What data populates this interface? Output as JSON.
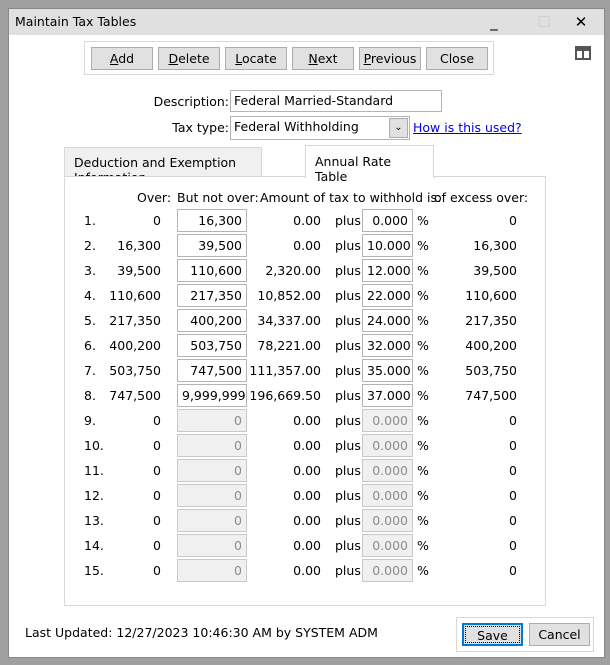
{
  "window": {
    "title": "Maintain Tax Tables",
    "minimize": "_",
    "maximize": "☐",
    "close": "✕"
  },
  "toolbar": [
    {
      "key": "add",
      "pre": "",
      "u": "A",
      "post": "dd"
    },
    {
      "key": "delete",
      "pre": "",
      "u": "D",
      "post": "elete"
    },
    {
      "key": "locate",
      "pre": "",
      "u": "L",
      "post": "ocate"
    },
    {
      "key": "next",
      "pre": "",
      "u": "N",
      "post": "ext"
    },
    {
      "key": "previous",
      "pre": "",
      "u": "P",
      "post": "revious"
    },
    {
      "key": "close",
      "pre": "Close",
      "u": "",
      "post": ""
    }
  ],
  "form": {
    "description_label": "Description:",
    "description_value": "Federal Married-Standard",
    "tax_type_label": "Tax type:",
    "tax_type_value": "Federal Withholding",
    "help_link": "How is this used?"
  },
  "tabs": [
    {
      "label": "Deduction and Exemption Information",
      "active": false
    },
    {
      "label": "Annual Rate Table",
      "active": true
    }
  ],
  "table": {
    "headers": {
      "over": "Over:",
      "not_over": "But not over:",
      "amount": "Amount of tax to withhold is:",
      "excess": "of excess over:"
    },
    "plus": "plus",
    "percent": "%",
    "rows": [
      [
        "1.",
        "0",
        "16,300",
        "0.00",
        "0.000",
        "0",
        true
      ],
      [
        "2.",
        "16,300",
        "39,500",
        "0.00",
        "10.000",
        "16,300",
        true
      ],
      [
        "3.",
        "39,500",
        "110,600",
        "2,320.00",
        "12.000",
        "39,500",
        true
      ],
      [
        "4.",
        "110,600",
        "217,350",
        "10,852.00",
        "22.000",
        "110,600",
        true
      ],
      [
        "5.",
        "217,350",
        "400,200",
        "34,337.00",
        "24.000",
        "217,350",
        true
      ],
      [
        "6.",
        "400,200",
        "503,750",
        "78,221.00",
        "32.000",
        "400,200",
        true
      ],
      [
        "7.",
        "503,750",
        "747,500",
        "111,357.00",
        "35.000",
        "503,750",
        true
      ],
      [
        "8.",
        "747,500",
        "9,999,999",
        "196,669.50",
        "37.000",
        "747,500",
        true
      ],
      [
        "9.",
        "0",
        "0",
        "0.00",
        "0.000",
        "0",
        false
      ],
      [
        "10.",
        "0",
        "0",
        "0.00",
        "0.000",
        "0",
        false
      ],
      [
        "11.",
        "0",
        "0",
        "0.00",
        "0.000",
        "0",
        false
      ],
      [
        "12.",
        "0",
        "0",
        "0.00",
        "0.000",
        "0",
        false
      ],
      [
        "13.",
        "0",
        "0",
        "0.00",
        "0.000",
        "0",
        false
      ],
      [
        "14.",
        "0",
        "0",
        "0.00",
        "0.000",
        "0",
        false
      ],
      [
        "15.",
        "0",
        "0",
        "0.00",
        "0.000",
        "0",
        false
      ]
    ]
  },
  "footer": {
    "last_updated": "Last Updated: 12/27/2023 10:46:30 AM by SYSTEM ADM",
    "save": "Save",
    "cancel": "Cancel"
  },
  "colors": {
    "link": "#0000ee",
    "focus": "#0078d7",
    "titlebar": "#e0e0e0"
  }
}
